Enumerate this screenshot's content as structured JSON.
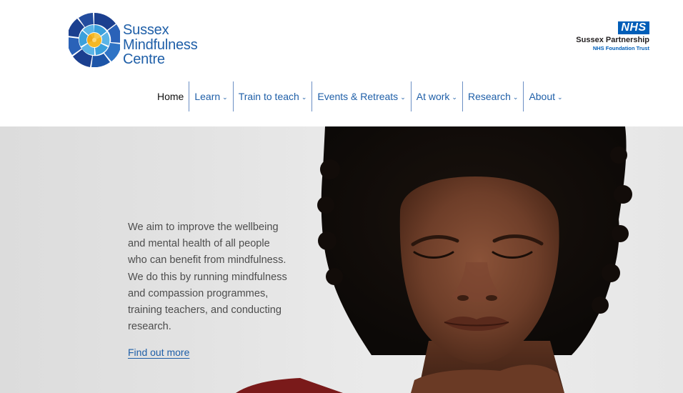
{
  "brand": {
    "name_lines": [
      "Sussex",
      "Mindfulness",
      "Centre"
    ],
    "logo_icon": "spiral-shell-icon",
    "colors": {
      "primary": "#1f5fa8",
      "dark_blue": "#1b3f8f",
      "light_blue": "#3aa0dc",
      "yellow": "#f5b825"
    }
  },
  "partner": {
    "badge": "NHS",
    "line1": "Sussex Partnership",
    "line2": "NHS Foundation Trust",
    "color": "#005eb8"
  },
  "nav": {
    "items": [
      {
        "label": "Home",
        "has_dropdown": false
      },
      {
        "label": "Learn",
        "has_dropdown": true
      },
      {
        "label": "Train to teach",
        "has_dropdown": true
      },
      {
        "label": "Events & Retreats",
        "has_dropdown": true
      },
      {
        "label": "At work",
        "has_dropdown": true
      },
      {
        "label": "Research",
        "has_dropdown": true
      },
      {
        "label": "About",
        "has_dropdown": true
      }
    ],
    "chevron_icon": "chevron-down-icon",
    "chevron_glyph": "⌄"
  },
  "hero": {
    "text": "We aim to improve the wellbeing and mental health of all people who can benefit from mindfulness. We do this by running mindfulness and compassion programmes, training teachers, and conducting research.",
    "link": "Find out more"
  }
}
